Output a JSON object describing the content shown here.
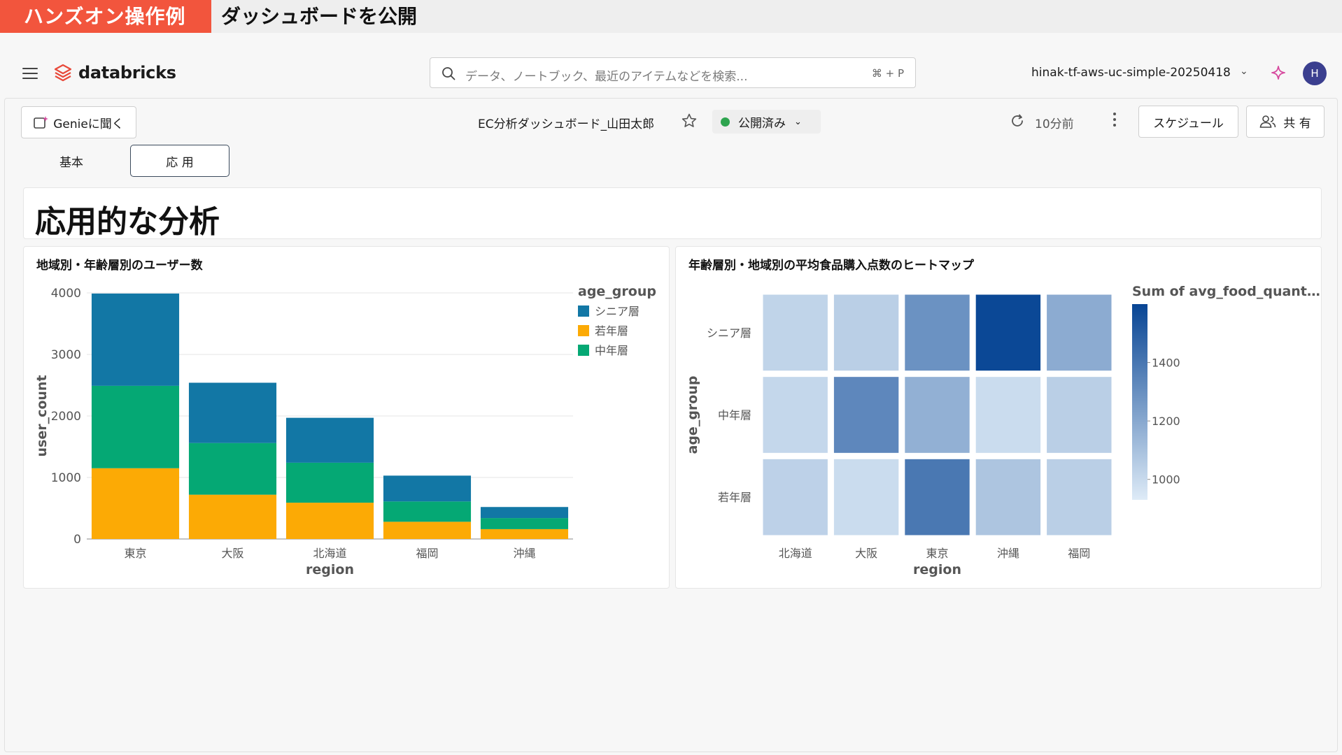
{
  "banner": {
    "tag": "ハンズオン操作例",
    "title": "ダッシュボードを公開"
  },
  "nav": {
    "logo": "databricks",
    "search_placeholder": "データ、ノートブック、最近のアイテムなどを検索...",
    "search_shortcut": "⌘ + P",
    "workspace": "hinak-tf-aws-uc-simple-20250418",
    "avatar": "H"
  },
  "toolbar": {
    "genie_label": "Genieに聞く",
    "dashboard_title": "EC分析ダッシュボード_山田太郎",
    "status": "公開済み",
    "refresh_time": "10分前",
    "schedule_label": "スケジュール",
    "share_label": "共 有"
  },
  "tabs": [
    {
      "label": "基本"
    },
    {
      "label": "応 用",
      "active": true
    }
  ],
  "page": {
    "title": "応用的な分析"
  },
  "colors": {
    "accent_banner": "#f2553d",
    "senior": "#1277a5",
    "young": "#fcaa05",
    "middle": "#05a874"
  },
  "chart_data": [
    {
      "type": "bar",
      "stacked": true,
      "title": "地域別・年齢層別のユーザー数",
      "xlabel": "region",
      "ylabel": "user_count",
      "ylim": [
        0,
        4000
      ],
      "yticks": [
        0,
        1000,
        2000,
        3000,
        4000
      ],
      "legend_title": "age_group",
      "legend_position": "right",
      "categories": [
        "東京",
        "大阪",
        "北海道",
        "福岡",
        "沖縄"
      ],
      "series": [
        {
          "name": "若年層",
          "color": "#fcaa05",
          "values": [
            1150,
            720,
            590,
            280,
            160
          ]
        },
        {
          "name": "中年層",
          "color": "#05a874",
          "values": [
            1340,
            840,
            650,
            330,
            180
          ]
        },
        {
          "name": "シニア層",
          "color": "#1277a5",
          "values": [
            1500,
            980,
            730,
            420,
            180
          ]
        }
      ],
      "legend_order": [
        "シニア層",
        "若年層",
        "中年層"
      ]
    },
    {
      "type": "heatmap",
      "title": "年齢層別・地域別の平均食品購入点数のヒートマップ",
      "xlabel": "region",
      "ylabel": "age_group",
      "x": [
        "北海道",
        "大阪",
        "東京",
        "沖縄",
        "福岡"
      ],
      "y": [
        "シニア層",
        "中年層",
        "若年層"
      ],
      "values": [
        [
          1040,
          1060,
          1300,
          1590,
          1200
        ],
        [
          1030,
          1340,
          1180,
          1010,
          1060
        ],
        [
          1050,
          1010,
          1400,
          1100,
          1060
        ]
      ],
      "colorbar_title": "Sum of avg_food_quant…",
      "colorbar_ticks": [
        1000,
        1200,
        1400
      ],
      "color_range": [
        950,
        1600
      ]
    }
  ]
}
